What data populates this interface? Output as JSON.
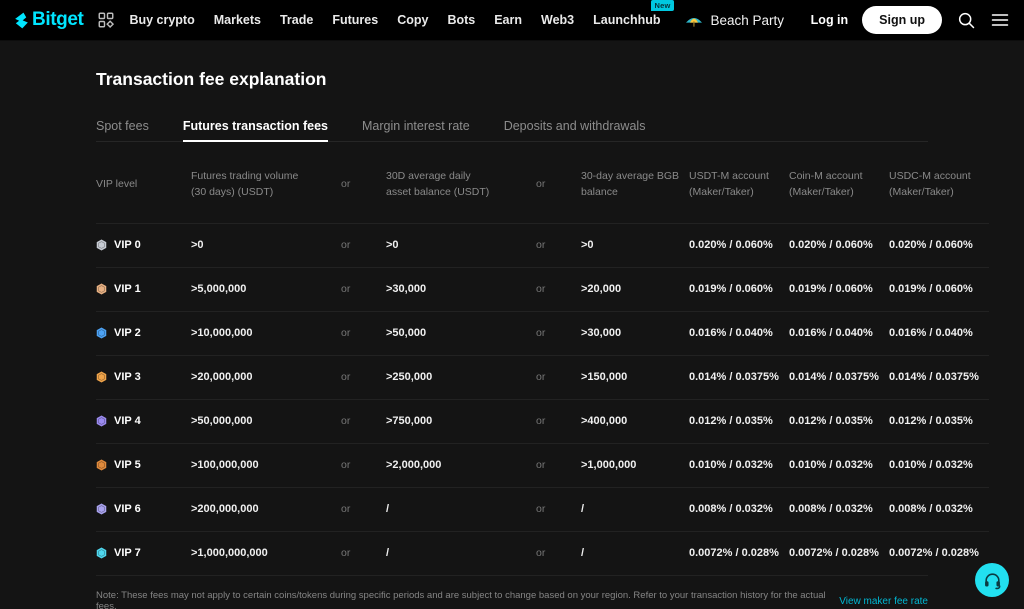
{
  "nav": {
    "brand": "Bitget",
    "apps_icon": "grid-apps-icon",
    "links": [
      {
        "label": "Buy crypto"
      },
      {
        "label": "Markets"
      },
      {
        "label": "Trade"
      },
      {
        "label": "Futures"
      },
      {
        "label": "Copy"
      },
      {
        "label": "Bots"
      },
      {
        "label": "Earn"
      },
      {
        "label": "Web3"
      },
      {
        "label": "Launchhub",
        "badge": "New"
      }
    ],
    "promo": {
      "label": "Beach Party",
      "icon": "beach-umbrella-icon"
    },
    "login_label": "Log in",
    "signup_label": "Sign up",
    "search_icon": "search-icon",
    "menu_icon": "hamburger-menu-icon",
    "accent": "#00e5ff"
  },
  "page": {
    "title": "Transaction fee explanation"
  },
  "tabs": [
    {
      "label": "Spot fees",
      "active": false
    },
    {
      "label": "Futures transaction fees",
      "active": true
    },
    {
      "label": "Margin interest rate",
      "active": false
    },
    {
      "label": "Deposits and withdrawals",
      "active": false
    }
  ],
  "table": {
    "headers": {
      "vip_level": "VIP level",
      "futures_volume_l1": "Futures trading volume",
      "futures_volume_l2": "(30 days) (USDT)",
      "or_1": "or",
      "asset_balance_l1": "30D average daily",
      "asset_balance_l2": "asset balance (USDT)",
      "or_2": "or",
      "bgb_balance_l1": "30-day average BGB",
      "bgb_balance_l2": "balance",
      "usdt_m_l1": "USDT-M account",
      "usdt_m_l2": "(Maker/Taker)",
      "coin_m_l1": "Coin-M account",
      "coin_m_l2": "(Maker/Taker)",
      "usdc_m_l1": "USDC-M account",
      "usdc_m_l2": "(Maker/Taker)"
    },
    "rows": [
      {
        "vip": "VIP 0",
        "badge_color": "#c8ccd4",
        "volume": ">0",
        "or1": "or",
        "asset": ">0",
        "or2": "or",
        "bgb": ">0",
        "usdt_m": "0.020% / 0.060%",
        "coin_m": "0.020% / 0.060%",
        "usdc_m": "0.020% / 0.060%"
      },
      {
        "vip": "VIP 1",
        "badge_color": "#e8b183",
        "volume": ">5,000,000",
        "or1": "or",
        "asset": ">30,000",
        "or2": "or",
        "bgb": ">20,000",
        "usdt_m": "0.019% / 0.060%",
        "coin_m": "0.019% / 0.060%",
        "usdc_m": "0.019% / 0.060%"
      },
      {
        "vip": "VIP 2",
        "badge_color": "#4da3f5",
        "volume": ">10,000,000",
        "or1": "or",
        "asset": ">50,000",
        "or2": "or",
        "bgb": ">30,000",
        "usdt_m": "0.016% / 0.040%",
        "coin_m": "0.016% / 0.040%",
        "usdc_m": "0.016% / 0.040%"
      },
      {
        "vip": "VIP 3",
        "badge_color": "#f0a44a",
        "volume": ">20,000,000",
        "or1": "or",
        "asset": ">250,000",
        "or2": "or",
        "bgb": ">150,000",
        "usdt_m": "0.014% / 0.0375%",
        "coin_m": "0.014% / 0.0375%",
        "usdc_m": "0.014% / 0.0375%"
      },
      {
        "vip": "VIP 4",
        "badge_color": "#9b8bf0",
        "volume": ">50,000,000",
        "or1": "or",
        "asset": ">750,000",
        "or2": "or",
        "bgb": ">400,000",
        "usdt_m": "0.012% / 0.035%",
        "coin_m": "0.012% / 0.035%",
        "usdc_m": "0.012% / 0.035%"
      },
      {
        "vip": "VIP 5",
        "badge_color": "#e08a3c",
        "volume": ">100,000,000",
        "or1": "or",
        "asset": ">2,000,000",
        "or2": "or",
        "bgb": ">1,000,000",
        "usdt_m": "0.010% / 0.032%",
        "coin_m": "0.010% / 0.032%",
        "usdc_m": "0.010% / 0.032%"
      },
      {
        "vip": "VIP 6",
        "badge_color": "#a9a3ef",
        "volume": ">200,000,000",
        "or1": "or",
        "asset": "/",
        "or2": "or",
        "bgb": "/",
        "usdt_m": "0.008% / 0.032%",
        "coin_m": "0.008% / 0.032%",
        "usdc_m": "0.008% / 0.032%"
      },
      {
        "vip": "VIP 7",
        "badge_color": "#4fd8ef",
        "volume": ">1,000,000,000",
        "or1": "or",
        "asset": "/",
        "or2": "or",
        "bgb": "/",
        "usdt_m": "0.0072% / 0.028%",
        "coin_m": "0.0072% / 0.028%",
        "usdc_m": "0.0072% / 0.028%"
      }
    ]
  },
  "footer": {
    "note": "Note: These fees may not apply to certain coins/tokens during specific periods and are subject to change based on your region. Refer to your transaction history for the actual fees.",
    "maker_link": "View maker fee rate",
    "link_color": "#00b8d4"
  },
  "support": {
    "icon": "headset-support-icon",
    "color": "#22e0f0"
  }
}
